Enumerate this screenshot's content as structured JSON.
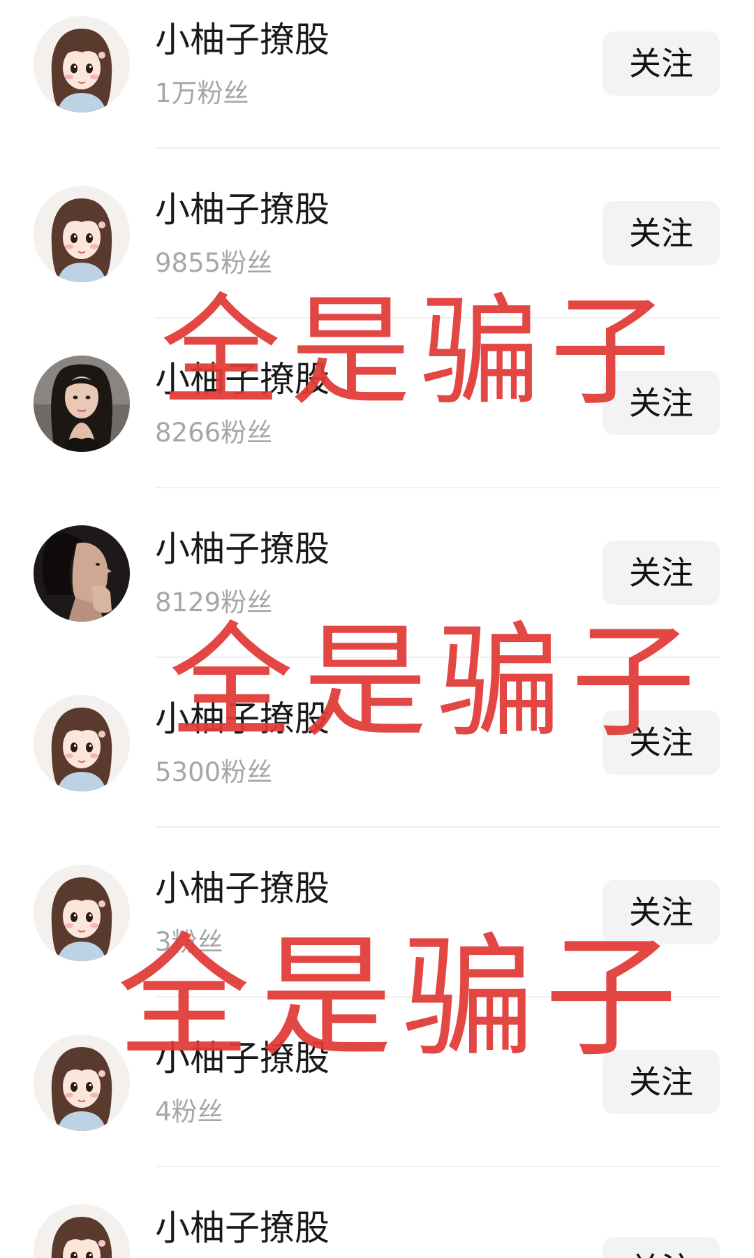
{
  "follow_list": {
    "items": [
      {
        "name": "小柚子撩股",
        "fans": "1万粉丝",
        "button": "关注",
        "avatar": "cartoon-girl"
      },
      {
        "name": "小柚子撩股",
        "fans": "9855粉丝",
        "button": "关注",
        "avatar": "cartoon-girl"
      },
      {
        "name": "小柚子撩股",
        "fans": "8266粉丝",
        "button": "关注",
        "avatar": "woman-photo"
      },
      {
        "name": "小柚子撩股",
        "fans": "8129粉丝",
        "button": "关注",
        "avatar": "woman-profile-photo"
      },
      {
        "name": "小柚子撩股",
        "fans": "5300粉丝",
        "button": "关注",
        "avatar": "cartoon-girl"
      },
      {
        "name": "小柚子撩股",
        "fans": "3粉丝",
        "button": "关注",
        "avatar": "cartoon-girl"
      },
      {
        "name": "小柚子撩股",
        "fans": "4粉丝",
        "button": "关注",
        "avatar": "cartoon-girl"
      },
      {
        "name": "小柚子撩股",
        "fans": "",
        "button": "关注",
        "avatar": "cartoon-girl"
      }
    ]
  },
  "overlay": {
    "texts": [
      "全是骗子",
      "全是骗子",
      "全是骗子"
    ],
    "color": "#e03a36"
  },
  "colors": {
    "name_text": "#1a1a1a",
    "fans_text": "#a6a6a6",
    "button_bg": "#f3f3f3",
    "divider": "#efefef"
  }
}
